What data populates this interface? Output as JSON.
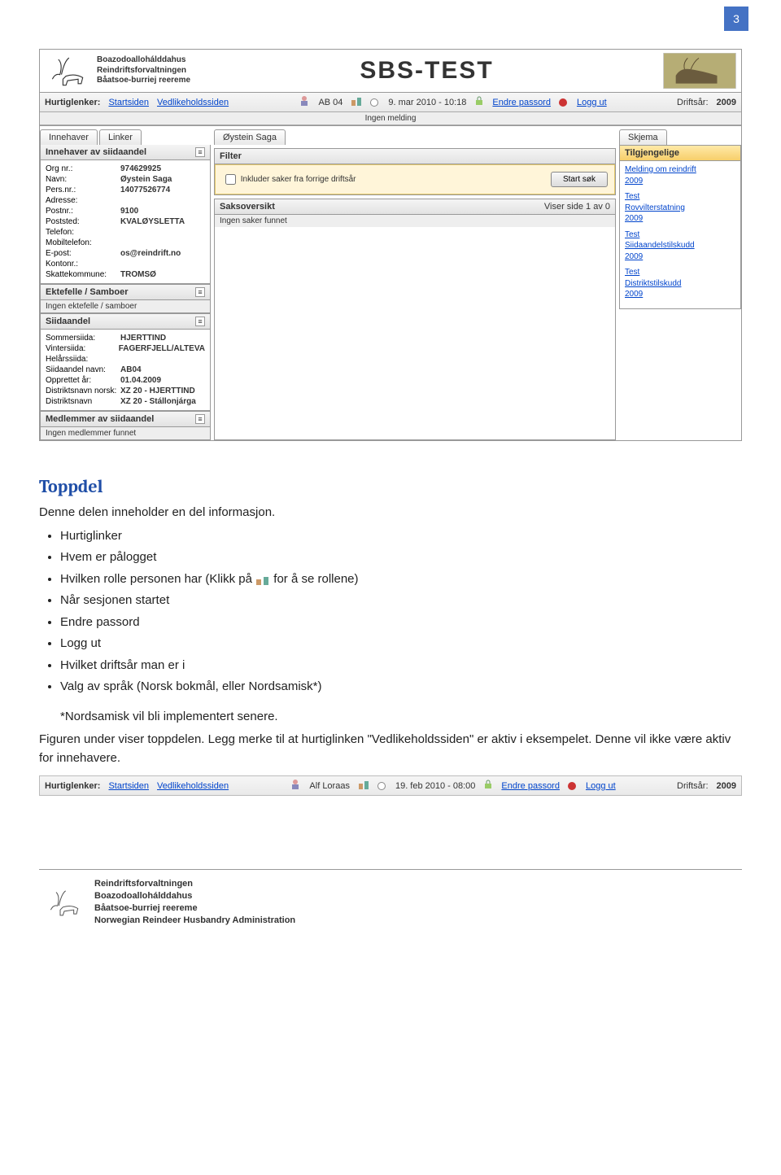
{
  "pageNumber": "3",
  "header": {
    "orgLines": [
      "Boazodoallohálddahus",
      "Reindriftsforvaltningen",
      "Båatsoe-burriej reereme"
    ],
    "appTitle": "SBS-TEST"
  },
  "toolbar": {
    "label": "Hurtiglenker:",
    "links": {
      "start": "Startsiden",
      "maint": "Vedlikeholdssiden"
    },
    "roleCode": "AB 04",
    "datetime": "9. mar 2010 - 10:18",
    "changePwd": "Endre passord",
    "logout": "Logg ut",
    "yearLabel": "Driftsår:",
    "year": "2009"
  },
  "barNote": "Ingen melding",
  "tabs": {
    "innehaver": "Innehaver",
    "linker": "Linker",
    "userName": "Øystein Saga",
    "skjema": "Skjema"
  },
  "left": {
    "p1Title": "Innehaver av siidaandel",
    "p1": [
      {
        "l": "Org nr.:",
        "v": "974629925"
      },
      {
        "l": "Navn:",
        "v": "Øystein Saga"
      },
      {
        "l": "Pers.nr.:",
        "v": "14077526774"
      },
      {
        "l": "Adresse:",
        "v": ""
      },
      {
        "l": "Postnr.:",
        "v": "9100"
      },
      {
        "l": "Poststed:",
        "v": "KVALØYSLETTA"
      },
      {
        "l": "Telefon:",
        "v": ""
      },
      {
        "l": "Mobiltelefon:",
        "v": ""
      },
      {
        "l": "E-post:",
        "v": "os@reindrift.no"
      },
      {
        "l": "Kontonr.:",
        "v": ""
      },
      {
        "l": "Skattekommune:",
        "v": "TROMSØ"
      }
    ],
    "p2Title": "Ektefelle / Samboer",
    "p2Empty": "Ingen ektefelle / samboer",
    "p3Title": "Siidaandel",
    "p3": [
      {
        "l": "Sommersiida:",
        "v": "HJERTTIND"
      },
      {
        "l": "Vintersiida:",
        "v": "FAGERFJELL/ALTEVA"
      },
      {
        "l": "Helårssiida:",
        "v": ""
      },
      {
        "l": "Siidaandel navn:",
        "v": "AB04"
      },
      {
        "l": "Opprettet år:",
        "v": "01.04.2009"
      },
      {
        "l": "Distriktsnavn norsk:",
        "v": "XZ 20 - HJERTTIND"
      },
      {
        "l": "Distriktsnavn",
        "v": "XZ 20 - Stállonjárga"
      }
    ],
    "p4Title": "Medlemmer av siidaandel",
    "p4Empty": "Ingen medlemmer funnet"
  },
  "mid": {
    "filterTitle": "Filter",
    "filterCheckbox": "Inkluder saker fra forrige driftsår",
    "searchBtn": "Start søk",
    "sak_title": "Saksoversikt",
    "sak_pager": "Viser side 1 av 0",
    "sak_empty": "Ingen saker funnet"
  },
  "right": {
    "title": "Tilgjengelige",
    "groups": [
      [
        "Melding om reindrift",
        "2009"
      ],
      [
        "Test",
        "Rovvilterstatning",
        "2009"
      ],
      [
        "Test",
        "Siidaandelstilskudd",
        "2009"
      ],
      [
        "Test",
        "Distriktstilskudd",
        "2009"
      ]
    ]
  },
  "article": {
    "h2": "Toppdel",
    "intro": "Denne delen inneholder en del  informasjon.",
    "bullets": [
      "Hurtiglinker",
      "Hvem er pålogget",
      {
        "pre": "Hvilken rolle personen har  (Klikk på  ",
        "post": "  for å se rollene)"
      },
      "Når sesjonen startet",
      "Endre passord",
      "Logg ut",
      "Hvilket driftsår man er i",
      "Valg av språk (Norsk bokmål, eller Nordsamisk*)"
    ],
    "note": "*Nordsamisk vil bli implementert senere.",
    "figCaption": "Figuren under viser toppdelen. Legg merke til at hurtiglinken \"Vedlikeholdssiden\" er aktiv i eksempelet. Denne vil ikke være aktiv for innehavere."
  },
  "toolbar2": {
    "label": "Hurtiglenker:",
    "links": {
      "start": "Startsiden",
      "maint": "Vedlikeholdssiden"
    },
    "user": "Alf Loraas",
    "datetime": "19. feb 2010 - 08:00",
    "changePwd": "Endre passord",
    "logout": "Logg ut",
    "yearLabel": "Driftsår:",
    "year": "2009"
  },
  "footer": {
    "lines": [
      "Reindriftsforvaltningen",
      "Boazodoallohálddahus",
      "Båatsoe-burriej reereme",
      "Norwegian Reindeer Husbandry Administration"
    ]
  }
}
